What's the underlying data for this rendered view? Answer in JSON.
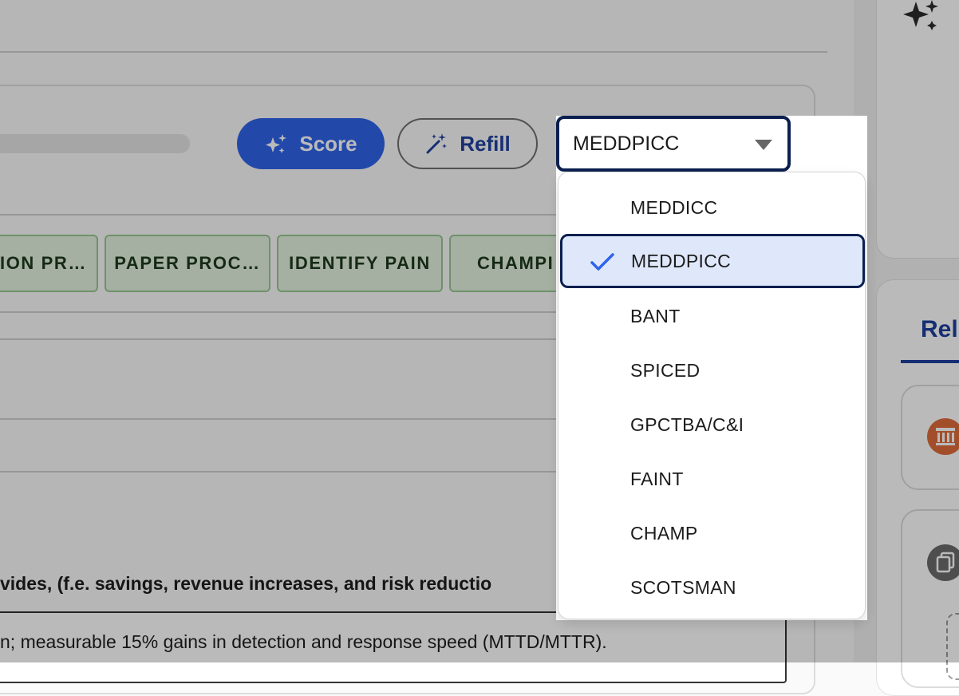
{
  "buttons": {
    "score_label": "Score",
    "refill_label": "Refill"
  },
  "progress": {
    "fill_fraction": 0.02,
    "color": "#f2b62b"
  },
  "methodology_select": {
    "selected": "MEDDPICC",
    "options": [
      {
        "label": "MEDDICC",
        "selected": false
      },
      {
        "label": "MEDDPICC",
        "selected": true
      },
      {
        "label": "BANT",
        "selected": false
      },
      {
        "label": "SPICED",
        "selected": false
      },
      {
        "label": "GPCTBA/C&I",
        "selected": false
      },
      {
        "label": "FAINT",
        "selected": false
      },
      {
        "label": "CHAMP",
        "selected": false
      },
      {
        "label": "SCOTSMAN",
        "selected": false
      }
    ]
  },
  "criteria_tabs": [
    "ION PR…",
    "PAPER PROC…",
    "IDENTIFY PAIN",
    "CHAMPI"
  ],
  "question_text": "vides, (f.e. savings, revenue increases, and risk reductio",
  "answer_text": "n; measurable 15% gains in detection and response speed (MTTD/MTTR).",
  "right_panel": {
    "tab_label": "Rel"
  },
  "colors": {
    "primary": "#2f63ea",
    "navy": "#0b1f4f",
    "chip_bg": "#e2f0de",
    "chip_border": "#97c990",
    "selected_option_bg": "#dfe8fb"
  }
}
